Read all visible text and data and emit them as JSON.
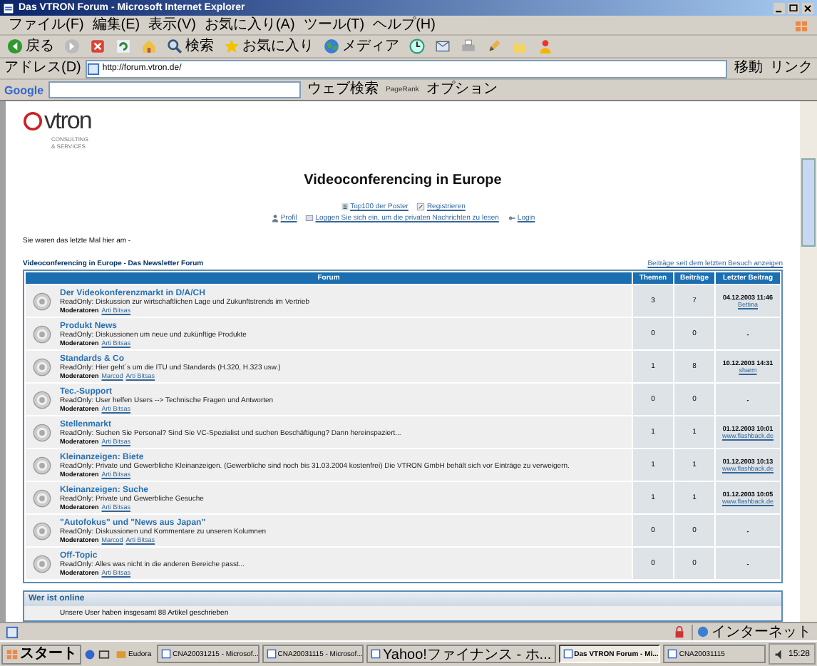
{
  "window": {
    "title": "Das VTRON Forum - Microsoft Internet Explorer"
  },
  "menu": [
    "ファイル(F)",
    "編集(E)",
    "表示(V)",
    "お気に入り(A)",
    "ツール(T)",
    "ヘルプ(H)"
  ],
  "toolbar": [
    {
      "kind": "back",
      "label": "戻る"
    },
    {
      "kind": "forward"
    },
    {
      "kind": "stop"
    },
    {
      "kind": "refresh"
    },
    {
      "kind": "home"
    },
    {
      "kind": "search",
      "label": "検索"
    },
    {
      "kind": "favorites",
      "label": "お気に入り"
    },
    {
      "kind": "media",
      "label": "メディア"
    },
    {
      "kind": "history"
    },
    {
      "kind": "mail"
    },
    {
      "kind": "print"
    },
    {
      "kind": "edit"
    },
    {
      "kind": "folder"
    },
    {
      "kind": "messenger"
    }
  ],
  "address": {
    "label": "アドレス(D)",
    "value": "http://forum.vtron.de/",
    "go": "移動",
    "links": "リンク"
  },
  "google": {
    "label": "Google",
    "search": "ウェブ検索",
    "pagerank": "PageRank",
    "options": "オプション"
  },
  "page": {
    "logo": {
      "name": "vtron",
      "sub": "CONSULTING & SERVICES"
    },
    "title": "Videoconferencing in Europe",
    "nav_top": [
      {
        "kind": "list",
        "label": "Top100 der Poster"
      },
      {
        "kind": "edit",
        "label": "Registrieren"
      }
    ],
    "nav_bottom": [
      {
        "kind": "user",
        "label": "Profil"
      },
      {
        "kind": "mail",
        "label": "Loggen Sie sich ein, um die privaten Nachrichten zu lesen"
      },
      {
        "kind": "key",
        "label": "Login"
      }
    ],
    "last_visit": "Sie waren das letzte Mal hier am -",
    "breadcrumb": "Videoconferencing in Europe - Das Newsletter Forum",
    "new_posts_link": "Beiträge seit dem letzten Besuch anzeigen",
    "table": {
      "columns": [
        "Forum",
        "Themen",
        "Beiträge",
        "Letzter Beitrag"
      ],
      "rows": [
        {
          "name": "Der Videokonferenzmarkt in D/A/CH",
          "description": "ReadOnly: Diskussion zur wirtschaftlichen Lage und Zukunftstrends im Vertrieb",
          "moderators_label": "Moderatoren",
          "moderators": [
            "Arti Bitsas"
          ],
          "topics": "3",
          "posts": "7",
          "last_post": "04.12.2003 11:46",
          "last_user": "Bettina"
        },
        {
          "name": "Produkt News",
          "description": "ReadOnly: Diskussionen um neue und zukünftige Produkte",
          "moderators_label": "Moderatoren",
          "moderators": [
            "Arti Bitsas"
          ],
          "topics": "0",
          "posts": "0",
          "last_post": "-"
        },
        {
          "name": "Standards & Co",
          "description": "ReadOnly: Hier geht´s um die ITU und Standards (H.320, H.323 usw.)",
          "moderators_label": "Moderatoren",
          "moderators": [
            "Marcod",
            "Arti Bitsas"
          ],
          "topics": "1",
          "posts": "8",
          "last_post": "10.12.2003 14:31",
          "last_user": "sharm"
        },
        {
          "name": "Tec.-Support",
          "description": "ReadOnly: User helfen Users --> Technische Fragen und Antworten",
          "moderators_label": "Moderatoren",
          "moderators": [
            "Arti Bitsas"
          ],
          "topics": "0",
          "posts": "0",
          "last_post": "-"
        },
        {
          "name": "Stellenmarkt",
          "description": "ReadOnly: Suchen Sie Personal? Sind Sie VC-Spezialist und suchen Beschäftigung? Dann hereinspaziert...",
          "moderators_label": "Moderatoren",
          "moderators": [
            "Arti Bitsas"
          ],
          "topics": "1",
          "posts": "1",
          "last_post": "01.12.2003 10:01",
          "last_user": "www.flashback.de"
        },
        {
          "name": "Kleinanzeigen: Biete",
          "description": "ReadOnly: Private und Gewerbliche Kleinanzeigen. (Gewerbliche sind noch bis 31.03.2004 kostenfrei) Die VTRON GmbH behält sich vor Einträge zu verweigern.",
          "moderators_label": "Moderatoren",
          "moderators": [
            "Arti Bitsas"
          ],
          "topics": "1",
          "posts": "1",
          "last_post": "01.12.2003 10:13",
          "last_user": "www.flashback.de"
        },
        {
          "name": "Kleinanzeigen: Suche",
          "description": "ReadOnly: Private und Gewerbliche Gesuche",
          "moderators_label": "Moderatoren",
          "moderators": [
            "Arti Bitsas"
          ],
          "topics": "1",
          "posts": "1",
          "last_post": "01.12.2003 10:05",
          "last_user": "www.flashback.de"
        },
        {
          "name": "\"Autofokus\" und \"News aus Japan\"",
          "description": "ReadOnly: Diskussionen und Kommentare zu unseren Kolumnen",
          "moderators_label": "Moderatoren",
          "moderators": [
            "Marcod",
            "Arti Bitsas"
          ],
          "topics": "0",
          "posts": "0",
          "last_post": "-"
        },
        {
          "name": "Off-Topic",
          "description": "ReadOnly: Alles was nicht in die anderen Bereiche passt...",
          "moderators_label": "Moderatoren",
          "moderators": [
            "Arti Bitsas"
          ],
          "topics": "0",
          "posts": "0",
          "last_post": "-"
        }
      ]
    },
    "online": {
      "title": "Wer ist online",
      "text": "Unsere User haben insgesamt 88 Artikel geschrieben"
    }
  },
  "status_bar": {
    "zone": "インターネット"
  },
  "taskbar": {
    "start": "スタート",
    "quick": "Eudora",
    "tasks": [
      {
        "label": "CNA20031215 - Microsof...",
        "selected": false
      },
      {
        "label": "CNA20031115 - Microsof...",
        "selected": false
      },
      {
        "label": "Yahoo!ファイナンス - ホ...",
        "selected": false
      },
      {
        "label": "Das VTRON Forum - Mi...",
        "selected": true
      },
      {
        "label": "CNA20031115",
        "selected": false
      }
    ],
    "clock": "15:28"
  }
}
